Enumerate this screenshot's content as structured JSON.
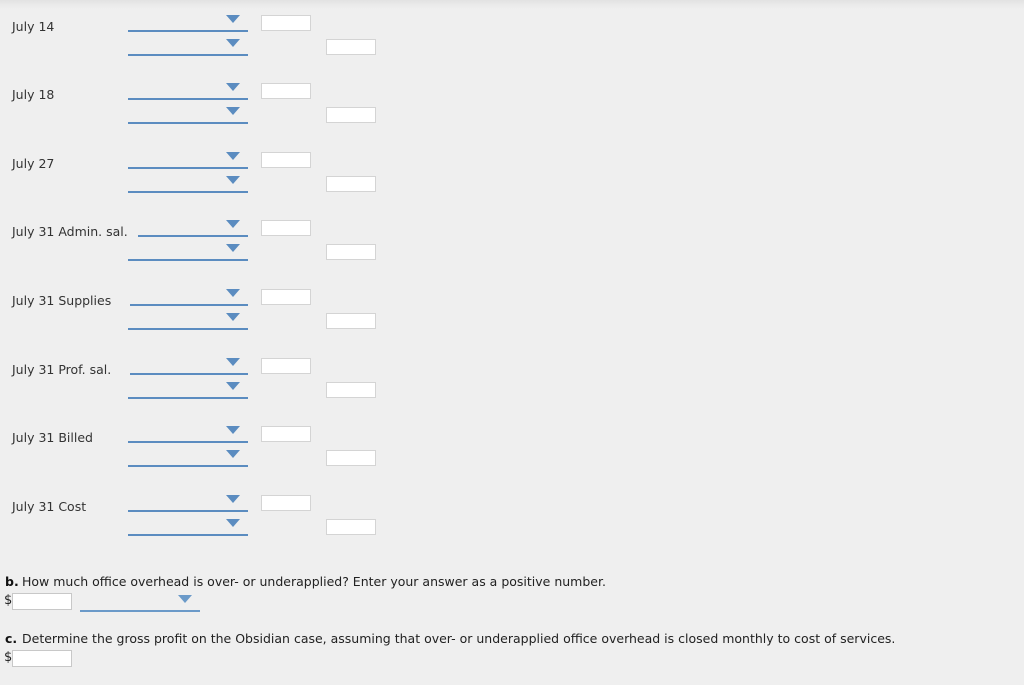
{
  "page": {
    "background_color": "#efefef",
    "accent_color": "#5b8cc0"
  },
  "journal": {
    "entries": [
      {
        "date_label": "July 14",
        "debit_account_value": "",
        "credit_account_value": "",
        "debit_amount_value": "",
        "credit_amount_value": ""
      },
      {
        "date_label": "July 18",
        "debit_account_value": "",
        "credit_account_value": "",
        "debit_amount_value": "",
        "credit_amount_value": ""
      },
      {
        "date_label": "July 27",
        "debit_account_value": "",
        "credit_account_value": "",
        "debit_amount_value": "",
        "credit_amount_value": ""
      },
      {
        "date_label": "July 31 Admin. sal.",
        "debit_account_value": "",
        "credit_account_value": "",
        "debit_amount_value": "",
        "credit_amount_value": ""
      },
      {
        "date_label": "July 31 Supplies",
        "debit_account_value": "",
        "credit_account_value": "",
        "debit_amount_value": "",
        "credit_amount_value": ""
      },
      {
        "date_label": "July 31 Prof. sal.",
        "debit_account_value": "",
        "credit_account_value": "",
        "debit_amount_value": "",
        "credit_amount_value": ""
      },
      {
        "date_label": "July 31 Billed",
        "debit_account_value": "",
        "credit_account_value": "",
        "debit_amount_value": "",
        "credit_amount_value": ""
      },
      {
        "date_label": "July 31 Cost",
        "debit_account_value": "",
        "credit_account_value": "",
        "debit_amount_value": "",
        "credit_amount_value": ""
      }
    ]
  },
  "question_b": {
    "marker": "b.",
    "text": "How much office overhead is over- or underapplied? Enter your answer as a positive number.",
    "currency_symbol": "$",
    "answer_value": "",
    "select_value": ""
  },
  "question_c": {
    "marker": "c.",
    "text": "Determine the gross profit on the Obsidian case, assuming that over- or underapplied office overhead is closed monthly to cost of services.",
    "currency_symbol": "$",
    "answer_value": ""
  }
}
